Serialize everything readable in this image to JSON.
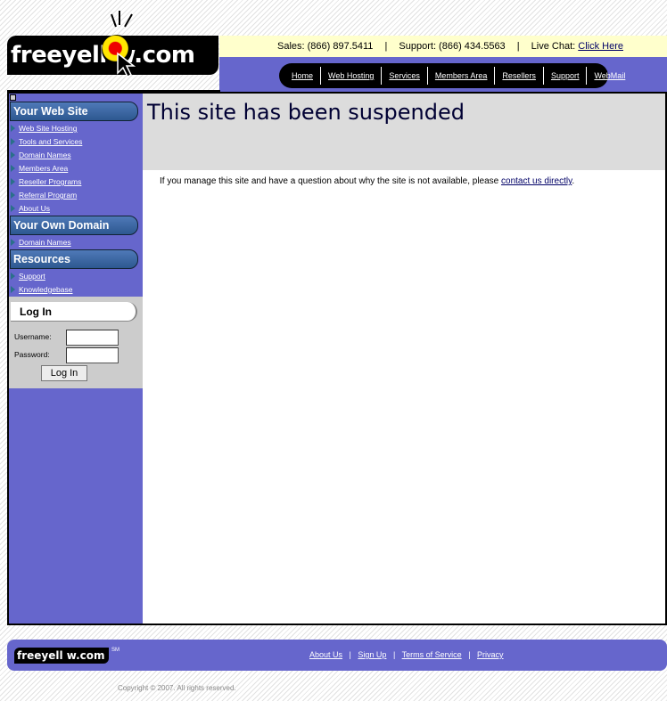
{
  "logo": {
    "text": "freeyell  w.com"
  },
  "contact": {
    "sales": "Sales: (866) 897.5411",
    "separator": "|",
    "support": "Support: (866) 434.5563",
    "live_chat_label": "Live Chat:",
    "live_chat_link": "Click Here"
  },
  "nav": [
    "Home",
    "Web Hosting",
    "Services",
    "Members Area",
    "Resellers",
    "Support",
    "WebMail"
  ],
  "sidebar": {
    "your_web_site": {
      "title": "Your Web Site",
      "links": [
        "Web Site Hosting",
        "Tools and Services",
        "Domain Names",
        "Members Area",
        "Reseller Programs",
        "Referral Program",
        "About Us"
      ]
    },
    "your_own_domain": {
      "title": "Your Own Domain",
      "links": [
        "Domain Names"
      ]
    },
    "resources": {
      "title": "Resources",
      "links": [
        "Support",
        "Knowledgebase"
      ]
    }
  },
  "login": {
    "title": "Log In",
    "username_label": "Username:",
    "password_label": "Password:",
    "button": "Log In"
  },
  "main": {
    "title": "This site has been suspended",
    "message": "If you manage this site and have a question about why the site is not available, please",
    "contact_link": "contact us directly",
    "message_end": "."
  },
  "footer": {
    "logo_text": "freeyell  w.com",
    "sm": "SM",
    "links": [
      "About Us",
      "Sign Up",
      "Terms of Service",
      "Privacy"
    ],
    "separator": "|",
    "copyright": "Copyright © 2007. All rights reserved."
  },
  "colors": {
    "nav_purple": "#6666cc",
    "contact_yellow": "#ffffcc",
    "banner_gray": "#dcdcdc",
    "header_blue": "#3a66a4"
  }
}
